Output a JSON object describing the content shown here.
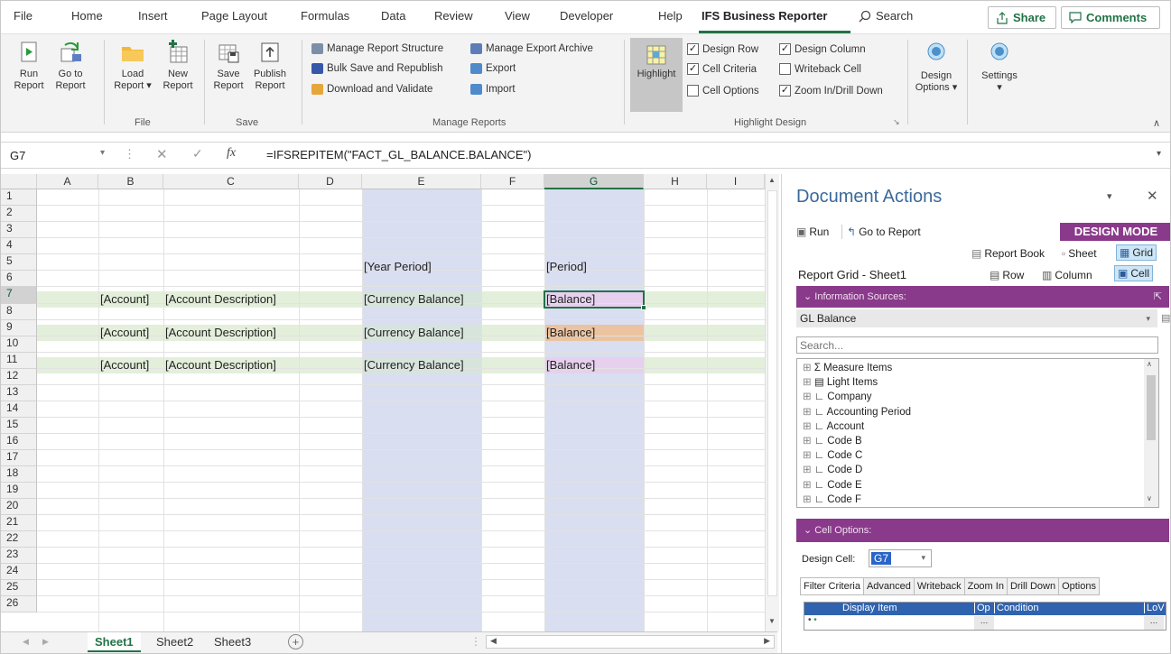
{
  "tabs": [
    "File",
    "Home",
    "Insert",
    "Page Layout",
    "Formulas",
    "Data",
    "Review",
    "View",
    "Developer",
    "Help",
    "IFS Business Reporter"
  ],
  "search_label": "Search",
  "share_label": "Share",
  "comments_label": "Comments",
  "ribbon": {
    "run": {
      "l1": "Run",
      "l2": "Report"
    },
    "goto": {
      "l1": "Go to",
      "l2": "Report"
    },
    "load": {
      "l1": "Load",
      "l2": "Report ▾"
    },
    "new": {
      "l1": "New",
      "l2": "Report"
    },
    "save": {
      "l1": "Save",
      "l2": "Report"
    },
    "publish": {
      "l1": "Publish",
      "l2": "Report"
    },
    "groups": {
      "file": "File",
      "save": "Save",
      "manage": "Manage Reports",
      "highlight": "Highlight Design"
    },
    "manage_items": [
      "Manage Report Structure",
      "Bulk Save and Republish",
      "Download and Validate",
      "Manage Export Archive",
      "Export",
      "Import"
    ],
    "highlight": "Highlight",
    "checks": [
      {
        "label": "Design Row",
        "checked": true
      },
      {
        "label": "Design Column",
        "checked": true
      },
      {
        "label": "Cell Criteria",
        "checked": true
      },
      {
        "label": "Writeback Cell",
        "checked": false
      },
      {
        "label": "Cell Options",
        "checked": false
      },
      {
        "label": "Zoom In/Drill Down",
        "checked": true
      }
    ],
    "design_options": {
      "l1": "Design",
      "l2": "Options ▾"
    },
    "settings": {
      "l1": "Settings",
      "l2": "▾"
    }
  },
  "formula": {
    "namebox": "G7",
    "fx": "fx",
    "content": "=IFSREPITEM(\"FACT_GL_BALANCE.BALANCE\")"
  },
  "grid": {
    "columns": [
      "A",
      "B",
      "C",
      "D",
      "E",
      "F",
      "G",
      "H",
      "I"
    ],
    "rows": [
      "1",
      "2",
      "3",
      "4",
      "5",
      "6",
      "7",
      "8",
      "9",
      "10",
      "11",
      "12",
      "13",
      "14",
      "15",
      "16",
      "17",
      "18",
      "19",
      "20",
      "21",
      "22",
      "23",
      "24",
      "25",
      "26"
    ],
    "cells": {
      "e5": "[Year Period]",
      "g5": "[Period]",
      "b7": "[Account]",
      "c7": "[Account Description]",
      "e7": "[Currency Balance]",
      "g7": "[Balance]",
      "b9": "[Account]",
      "c9": "[Account Description]",
      "e9": "[Currency Balance]",
      "g9": "[Balance]",
      "b11": "[Account]",
      "c11": "[Account Description]",
      "e11": "[Currency Balance]",
      "g11": "[Balance]"
    }
  },
  "sheets": [
    "Sheet1",
    "Sheet2",
    "Sheet3"
  ],
  "pane": {
    "title": "Document Actions",
    "run": "Run",
    "goto": "Go to Report",
    "design_mode": "DESIGN MODE",
    "report_book": "Report Book",
    "sheet": "Sheet",
    "grid": "Grid",
    "report_grid": "Report Grid - Sheet1",
    "row": "Row",
    "column": "Column",
    "cell": "Cell",
    "info_sources": "Information Sources:",
    "source": "GL Balance",
    "search_placeholder": "Search...",
    "tree": [
      "Σ Measure Items",
      "▤ Light Items",
      "∟ Company",
      "∟ Accounting Period",
      "∟ Account",
      "∟ Code B",
      "∟ Code C",
      "∟ Code D",
      "∟ Code E",
      "∟ Code F"
    ],
    "cell_options": "Cell Options:",
    "design_cell_label": "Design Cell:",
    "design_cell_value": "G7",
    "subtabs": [
      "Filter Criteria",
      "Advanced",
      "Writeback",
      "Zoom In",
      "Drill Down",
      "Options"
    ],
    "table_headers": [
      "Display Item",
      "Op",
      "Condition",
      "LoV"
    ]
  },
  "colors": {
    "accent": "#217346",
    "purple": "#8a3a8a",
    "design": "#1e64a8",
    "blue_col": "#d9def0",
    "green_row": "#e3efda"
  }
}
